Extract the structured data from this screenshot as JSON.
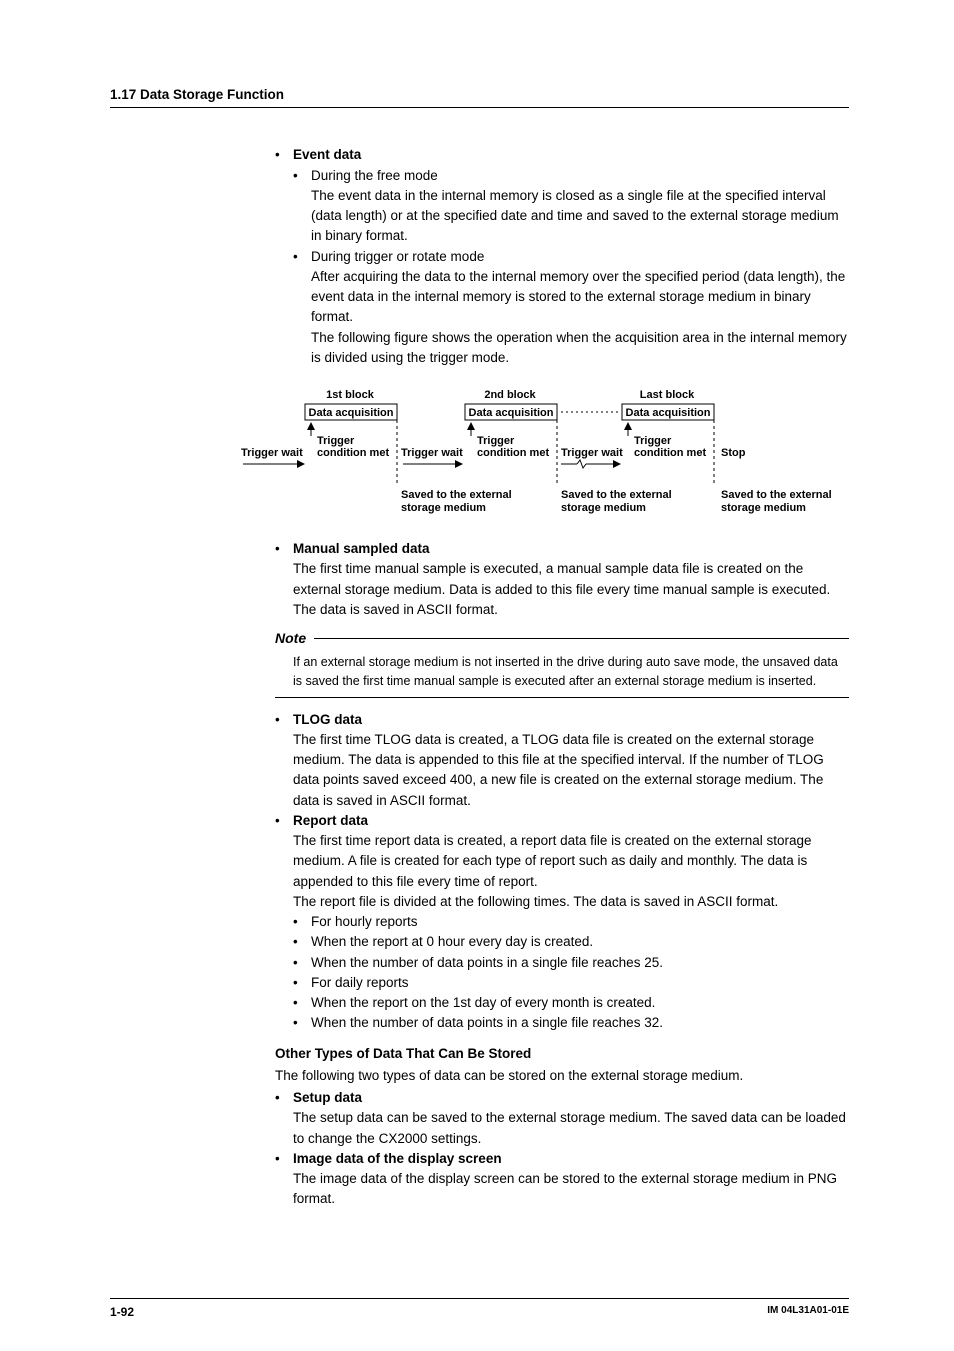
{
  "header": "1.17  Data Storage Function",
  "event": {
    "title": "Event data",
    "free": {
      "label": "During the free mode",
      "text": "The event data in the internal memory is closed as a single file at the specified interval (data length) or at the specified date and time and saved to the external storage medium in binary format."
    },
    "trigger": {
      "label": "During trigger or rotate mode",
      "text1": "After acquiring the data to the internal memory over the specified period (data length), the event data in the internal memory is stored to the external storage medium in binary format.",
      "text2": "The following figure shows the operation when the acquisition area in the internal memory is divided using the trigger mode."
    }
  },
  "diagram": {
    "block1": "1st block",
    "block2": "2nd block",
    "blockLast": "Last block",
    "dataAcq": "Data acquisition",
    "trigger": "Trigger",
    "condMet": "condition met",
    "trigWait": "Trigger wait",
    "stop": "Stop",
    "saved1": "Saved to the external",
    "saved2": "storage medium"
  },
  "manual": {
    "title": "Manual sampled data",
    "text": "The first time manual sample is executed, a manual sample data file is created on the external storage medium.  Data is added to this file every time manual sample is executed.  The data is saved in ASCII format."
  },
  "note": {
    "label": "Note",
    "text": "If an external storage medium is not inserted in the drive during auto save mode, the unsaved data is saved the first time manual sample is executed after an external storage medium is inserted."
  },
  "tlog": {
    "title": "TLOG data",
    "text": "The first time TLOG data is created, a TLOG data file is created on the external storage medium.  The data is appended to this file at the specified interval.  If the number of TLOG data points saved exceed 400, a new file is created on the external storage medium.  The data is saved in ASCII format."
  },
  "report": {
    "title": "Report data",
    "text1": "The first time report data is created, a report data file is created on the external storage medium.  A file is created for each type of report such as daily and monthly.  The data is appended to this file every time of report.",
    "text2": "The report file is divided at the following times.  The data is saved in ASCII format.",
    "items": [
      "For hourly reports",
      "When the report at 0 hour every day is created.",
      "When the number of data points in a single file reaches 25.",
      "For daily reports",
      "When the report on the 1st day of every month is created.",
      "When the number of data points in a single file reaches 32."
    ]
  },
  "other": {
    "title": "Other Types of Data That Can Be Stored",
    "intro": "The following two types of data can be stored on the external storage medium.",
    "setup": {
      "title": "Setup data",
      "text": "The setup data can be saved to the external storage medium.  The saved data can be loaded to change the CX2000 settings."
    },
    "image": {
      "title": "Image data of the display screen",
      "text": "The image data of the display screen can be stored to the external storage medium in PNG format."
    }
  },
  "footer": {
    "page": "1-92",
    "doc": "IM 04L31A01-01E"
  }
}
